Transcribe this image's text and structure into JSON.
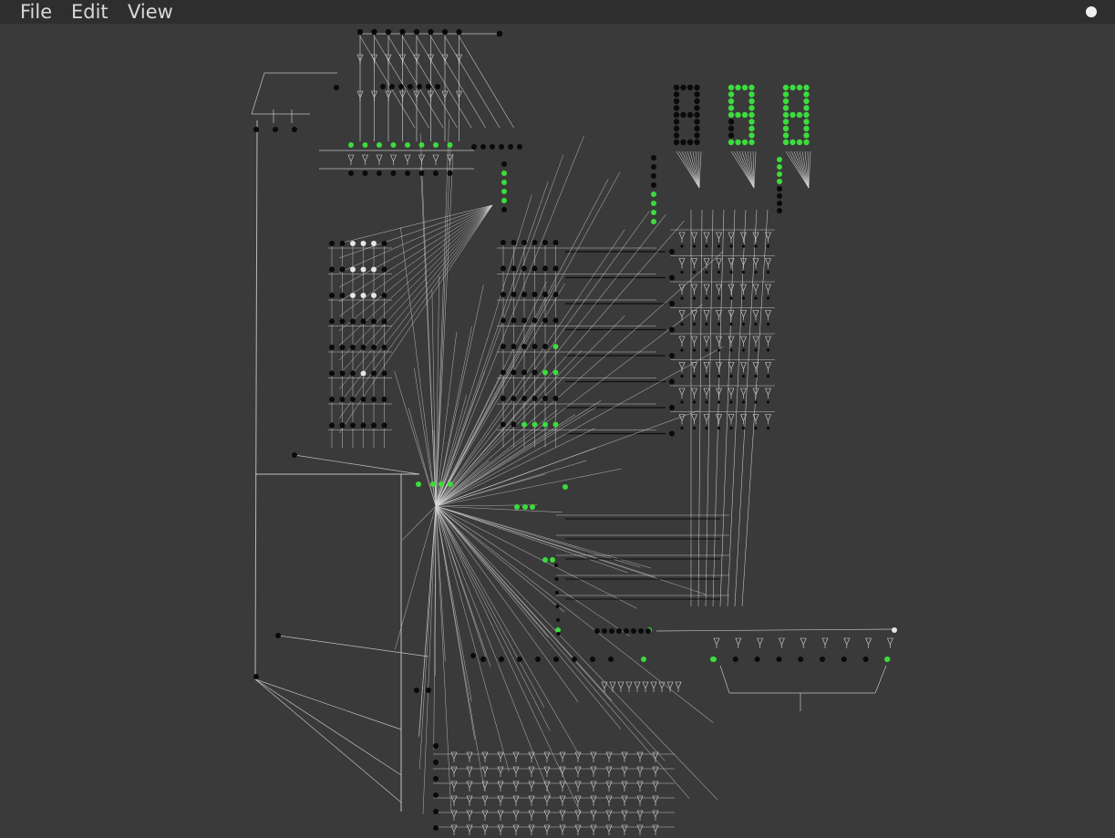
{
  "menu": {
    "items": [
      {
        "label": "File"
      },
      {
        "label": "Edit"
      },
      {
        "label": "View"
      }
    ]
  },
  "status_indicator": {
    "icon": "status-dot-icon",
    "color": "#f0f0f0"
  },
  "display": {
    "digits": [
      {
        "index": 0,
        "lit": false
      },
      {
        "index": 1,
        "lit": true
      },
      {
        "index": 2,
        "lit": true
      }
    ]
  },
  "colors": {
    "background": "#3a3a3a",
    "menubar": "#2e2e2e",
    "menu_text": "#d8d8d8",
    "wire": "#d8d8d8",
    "node_off": "#0a0a0a",
    "node_on": "#3cdc3c",
    "node_white": "#e6e6e6"
  }
}
